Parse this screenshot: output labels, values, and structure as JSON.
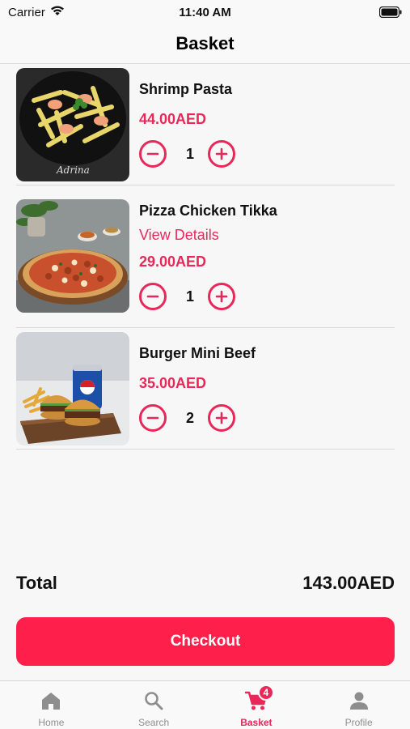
{
  "status_bar": {
    "carrier": "Carrier",
    "time": "11:40 AM"
  },
  "nav": {
    "title": "Basket"
  },
  "items": [
    {
      "name": "Shrimp Pasta",
      "price": "44.00AED",
      "quantity": "1"
    },
    {
      "name": "Pizza Chicken Tikka",
      "link": "View Details",
      "price": "29.00AED",
      "quantity": "1"
    },
    {
      "name": "Burger Mini Beef",
      "price": "35.00AED",
      "quantity": "2"
    }
  ],
  "summary": {
    "total_label": "Total",
    "total_value": "143.00AED"
  },
  "checkout": {
    "label": "Checkout"
  },
  "tabs": [
    {
      "label": "Home",
      "icon": "home-icon"
    },
    {
      "label": "Search",
      "icon": "search-icon"
    },
    {
      "label": "Basket",
      "icon": "cart-icon",
      "badge": "4",
      "active": true
    },
    {
      "label": "Profile",
      "icon": "person-icon"
    }
  ],
  "colors": {
    "accent": "#e9285a",
    "checkout": "#ff1f4b",
    "inactive": "#8e8e8e"
  }
}
